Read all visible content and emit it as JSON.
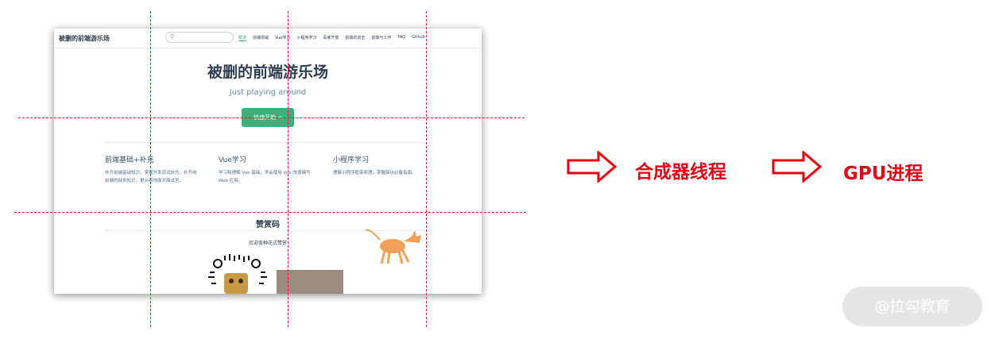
{
  "screenshot": {
    "site_name": "被删的前端游乐场",
    "nav": [
      "概述",
      "前端领域",
      "Vue学习",
      "小程序学习",
      "百家齐放",
      "前端的进击",
      "前端与工作",
      "FAQ",
      "Github"
    ],
    "hero_title": "被删的前端游乐场",
    "hero_description": "Just playing around",
    "hero_button": "快速开始 →",
    "features": [
      {
        "title": "前端基础+补充",
        "text": "补齐前端基础知识，掌握开发调试技巧。补齐纯前端的缺失知识，更从容地面对面试官。"
      },
      {
        "title": "Vue学习",
        "text": "学习和理解 Vue 基础，学会使用 Vue 快速编写 Web 应用。"
      },
      {
        "title": "小程序学习",
        "text": "理解小程序框架原理，掌握踩坑必备指南。"
      }
    ],
    "section_title": "赞赏码",
    "section_subtitle": "欢迎各种花式赞赏"
  },
  "flow": {
    "steps": [
      "合成器线程",
      "GPU进程"
    ],
    "color": "#e60012"
  },
  "watermark": "@拉勾教育"
}
